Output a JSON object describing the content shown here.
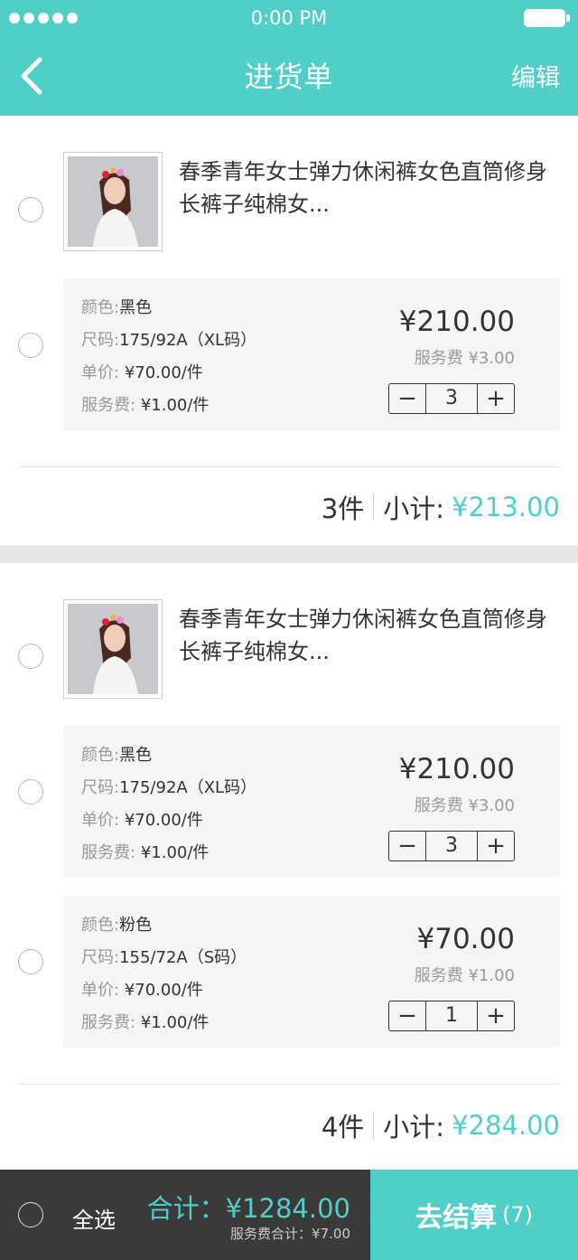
{
  "status": {
    "time": "0:00 PM"
  },
  "header": {
    "title": "进货单",
    "edit_label": "编辑",
    "back_icon": "chevron-left-icon"
  },
  "orders": [
    {
      "product_title": "春季青年女士弹力休闲裤女色直筒修身长裤子纯棉女...",
      "variants": [
        {
          "color_label": "颜色:",
          "color": "黑色",
          "size_label": "尺码:",
          "size": "175/92A（XL码）",
          "unit_label": "单价:",
          "unit_price": "¥70.00/件",
          "fee_label": "服务费:",
          "fee": "¥1.00/件",
          "price": "¥210.00",
          "service_fee": "服务费 ¥3.00",
          "qty": "3"
        }
      ],
      "count": "3件",
      "subtotal_label": "小计:",
      "subtotal": "¥213.00"
    },
    {
      "product_title": "春季青年女士弹力休闲裤女色直筒修身长裤子纯棉女...",
      "variants": [
        {
          "color_label": "颜色:",
          "color": "黑色",
          "size_label": "尺码:",
          "size": "175/92A（XL码）",
          "unit_label": "单价:",
          "unit_price": "¥70.00/件",
          "fee_label": "服务费:",
          "fee": "¥1.00/件",
          "price": "¥210.00",
          "service_fee": "服务费 ¥3.00",
          "qty": "3"
        },
        {
          "color_label": "颜色:",
          "color": "粉色",
          "size_label": "尺码:",
          "size": "155/72A（S码）",
          "unit_label": "单价:",
          "unit_price": "¥70.00/件",
          "fee_label": "服务费:",
          "fee": "¥1.00/件",
          "price": "¥70.00",
          "service_fee": "服务费 ¥1.00",
          "qty": "1"
        }
      ],
      "count": "4件",
      "subtotal_label": "小计:",
      "subtotal": "¥284.00"
    }
  ],
  "footer": {
    "select_all": "全选",
    "total": "合计：¥1284.00",
    "service_total": "服务费合计：¥7.00",
    "checkout_label": "去结算",
    "checkout_count": "(7)"
  },
  "colors": {
    "accent": "#4fcfc8",
    "footer_bg": "#3a3a3a"
  }
}
